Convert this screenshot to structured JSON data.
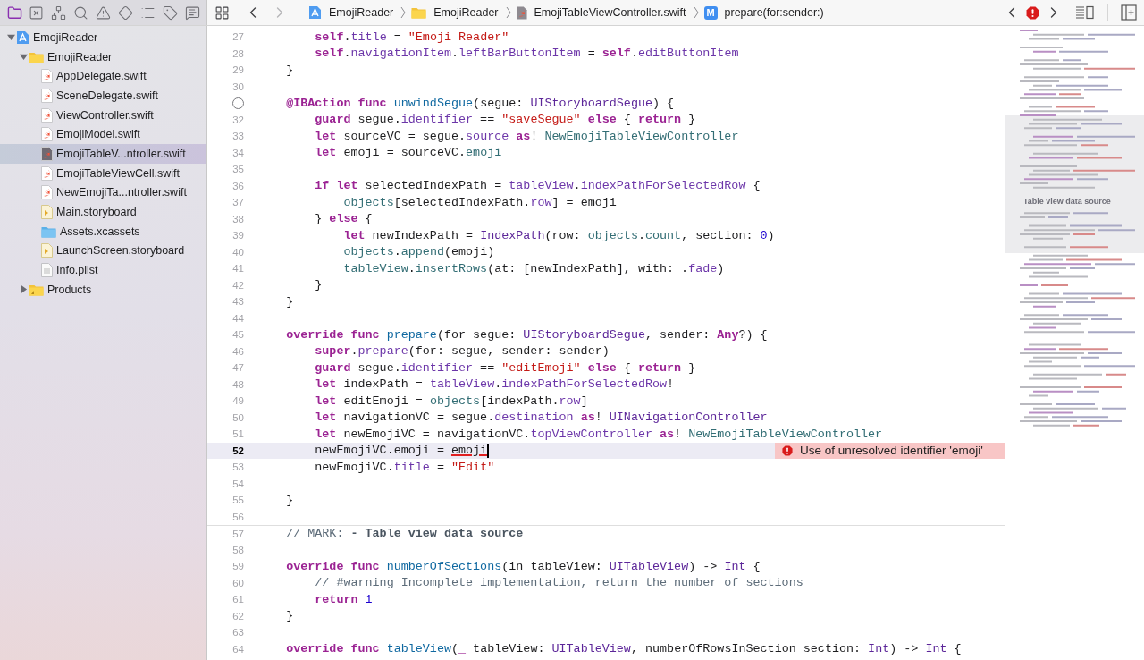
{
  "navigator": {
    "tabs": [
      {
        "selected": true
      },
      {
        "selected": false
      },
      {
        "selected": false
      },
      {
        "selected": false
      },
      {
        "selected": false
      },
      {
        "selected": false
      },
      {
        "selected": false
      },
      {
        "selected": false
      },
      {
        "selected": false
      }
    ],
    "tree": [
      {
        "name": "EmojiReader",
        "kind": "project",
        "expanded": true,
        "selected": false,
        "children": [
          {
            "name": "EmojiReader",
            "kind": "folder",
            "expanded": true,
            "selected": false,
            "children": [
              {
                "name": "AppDelegate.swift",
                "kind": "swift",
                "selected": false
              },
              {
                "name": "SceneDelegate.swift",
                "kind": "swift",
                "selected": false
              },
              {
                "name": "ViewController.swift",
                "kind": "swift",
                "selected": false
              },
              {
                "name": "EmojiModel.swift",
                "kind": "swift",
                "selected": false
              },
              {
                "name": "EmojiTableV...ntroller.swift",
                "kind": "swift",
                "selected": true
              },
              {
                "name": "EmojiTableViewCell.swift",
                "kind": "swift",
                "selected": false
              },
              {
                "name": "NewEmojiTa...ntroller.swift",
                "kind": "swift",
                "selected": false
              },
              {
                "name": "Main.storyboard",
                "kind": "storyboard",
                "selected": false
              },
              {
                "name": "Assets.xcassets",
                "kind": "assets",
                "selected": false
              },
              {
                "name": "LaunchScreen.storyboard",
                "kind": "storyboard",
                "selected": false
              },
              {
                "name": "Info.plist",
                "kind": "plist",
                "selected": false
              }
            ]
          },
          {
            "name": "Products",
            "kind": "products",
            "expanded": false,
            "selected": false
          }
        ]
      }
    ]
  },
  "editor": {
    "history": [
      {
        "disabled": false
      },
      {
        "disabled": true
      }
    ],
    "breadcrumbs": [
      {
        "kind": "project",
        "label": "EmojiReader"
      },
      {
        "kind": "folder",
        "label": "EmojiReader"
      },
      {
        "kind": "swift",
        "label": "EmojiTableViewController.swift"
      },
      {
        "kind": "method",
        "badge": "M",
        "label": "prepare(for:sender:)"
      }
    ],
    "lines": [
      {
        "number": "27",
        "tokens": [
          {
            "kind": "kw",
            "text": "        self"
          },
          {
            "kind": "plain",
            "text": "."
          },
          {
            "kind": "prop",
            "text": "title"
          },
          {
            "kind": "plain",
            "text": " = "
          },
          {
            "kind": "str",
            "text": "\"Emoji Reader\""
          }
        ]
      },
      {
        "number": "28",
        "tokens": [
          {
            "kind": "kw",
            "text": "        self"
          },
          {
            "kind": "plain",
            "text": "."
          },
          {
            "kind": "prop",
            "text": "navigationItem"
          },
          {
            "kind": "plain",
            "text": "."
          },
          {
            "kind": "prop",
            "text": "leftBarButtonItem"
          },
          {
            "kind": "plain",
            "text": " = "
          },
          {
            "kind": "kw",
            "text": "self"
          },
          {
            "kind": "plain",
            "text": "."
          },
          {
            "kind": "prop",
            "text": "editButtonItem"
          }
        ]
      },
      {
        "number": "29",
        "tokens": [
          {
            "kind": "plain",
            "text": "    }"
          }
        ]
      },
      {
        "number": "30"
      },
      {
        "connection": true,
        "tokens": [
          {
            "kind": "kw",
            "text": "    @IBAction func "
          },
          {
            "kind": "decl",
            "text": "unwindSegue"
          },
          {
            "kind": "plain",
            "text": "(segue: "
          },
          {
            "kind": "type",
            "text": "UIStoryboardSegue"
          },
          {
            "kind": "plain",
            "text": ") {"
          }
        ]
      },
      {
        "number": "32",
        "tokens": [
          {
            "kind": "kw",
            "text": "        guard"
          },
          {
            "kind": "plain",
            "text": " segue."
          },
          {
            "kind": "prop",
            "text": "identifier"
          },
          {
            "kind": "plain",
            "text": " == "
          },
          {
            "kind": "str",
            "text": "\"saveSegue\""
          },
          {
            "kind": "kw",
            "text": " else"
          },
          {
            "kind": "plain",
            "text": " { "
          },
          {
            "kind": "kw",
            "text": "return"
          },
          {
            "kind": "plain",
            "text": " }"
          }
        ]
      },
      {
        "number": "33",
        "tokens": [
          {
            "kind": "kw",
            "text": "        let"
          },
          {
            "kind": "plain",
            "text": " sourceVC = segue."
          },
          {
            "kind": "prop",
            "text": "source"
          },
          {
            "kind": "kw",
            "text": " as"
          },
          {
            "kind": "plain",
            "text": "! "
          },
          {
            "kind": "ptype",
            "text": "NewEmojiTableViewController"
          }
        ]
      },
      {
        "number": "34",
        "tokens": [
          {
            "kind": "kw",
            "text": "        let"
          },
          {
            "kind": "plain",
            "text": " emoji = sourceVC."
          },
          {
            "kind": "pprop",
            "text": "emoji"
          }
        ]
      },
      {
        "number": "35"
      },
      {
        "number": "36",
        "tokens": [
          {
            "kind": "kw",
            "text": "        if let"
          },
          {
            "kind": "plain",
            "text": " selectedIndexPath = "
          },
          {
            "kind": "prop",
            "text": "tableView"
          },
          {
            "kind": "plain",
            "text": "."
          },
          {
            "kind": "prop",
            "text": "indexPathForSelectedRow"
          },
          {
            "kind": "plain",
            "text": " {"
          }
        ]
      },
      {
        "number": "37",
        "tokens": [
          {
            "kind": "pprop",
            "text": "            objects"
          },
          {
            "kind": "plain",
            "text": "[selectedIndexPath."
          },
          {
            "kind": "prop",
            "text": "row"
          },
          {
            "kind": "plain",
            "text": "] = emoji"
          }
        ]
      },
      {
        "number": "38",
        "tokens": [
          {
            "kind": "plain",
            "text": "        } "
          },
          {
            "kind": "kw",
            "text": "else"
          },
          {
            "kind": "plain",
            "text": " {"
          }
        ]
      },
      {
        "number": "39",
        "tokens": [
          {
            "kind": "kw",
            "text": "            let"
          },
          {
            "kind": "plain",
            "text": " newIndexPath = "
          },
          {
            "kind": "type",
            "text": "IndexPath"
          },
          {
            "kind": "plain",
            "text": "(row: "
          },
          {
            "kind": "pprop",
            "text": "objects"
          },
          {
            "kind": "plain",
            "text": "."
          },
          {
            "kind": "pprop",
            "text": "count"
          },
          {
            "kind": "plain",
            "text": ", section: "
          },
          {
            "kind": "num",
            "text": "0"
          },
          {
            "kind": "plain",
            "text": ")"
          }
        ]
      },
      {
        "number": "40",
        "tokens": [
          {
            "kind": "pprop",
            "text": "            objects"
          },
          {
            "kind": "plain",
            "text": "."
          },
          {
            "kind": "pprop",
            "text": "append"
          },
          {
            "kind": "plain",
            "text": "(emoji)"
          }
        ]
      },
      {
        "number": "41",
        "tokens": [
          {
            "kind": "pprop",
            "text": "            tableView"
          },
          {
            "kind": "plain",
            "text": "."
          },
          {
            "kind": "pprop",
            "text": "insertRows"
          },
          {
            "kind": "plain",
            "text": "(at: [newIndexPath], with: ."
          },
          {
            "kind": "prop",
            "text": "fade"
          },
          {
            "kind": "plain",
            "text": ")"
          }
        ]
      },
      {
        "number": "42",
        "tokens": [
          {
            "kind": "plain",
            "text": "        }"
          }
        ]
      },
      {
        "number": "43",
        "tokens": [
          {
            "kind": "plain",
            "text": "    }"
          }
        ]
      },
      {
        "number": "44"
      },
      {
        "number": "45",
        "tokens": [
          {
            "kind": "kw",
            "text": "    override func "
          },
          {
            "kind": "decl",
            "text": "prepare"
          },
          {
            "kind": "plain",
            "text": "(for segue: "
          },
          {
            "kind": "type",
            "text": "UIStoryboardSegue"
          },
          {
            "kind": "plain",
            "text": ", sender: "
          },
          {
            "kind": "kw",
            "text": "Any"
          },
          {
            "kind": "plain",
            "text": "?) {"
          }
        ]
      },
      {
        "number": "46",
        "tokens": [
          {
            "kind": "kw",
            "text": "        super"
          },
          {
            "kind": "plain",
            "text": "."
          },
          {
            "kind": "prop",
            "text": "prepare"
          },
          {
            "kind": "plain",
            "text": "(for: segue, sender: sender)"
          }
        ]
      },
      {
        "number": "47",
        "tokens": [
          {
            "kind": "kw",
            "text": "        guard"
          },
          {
            "kind": "plain",
            "text": " segue."
          },
          {
            "kind": "prop",
            "text": "identifier"
          },
          {
            "kind": "plain",
            "text": " == "
          },
          {
            "kind": "str",
            "text": "\"editEmoji\""
          },
          {
            "kind": "kw",
            "text": " else"
          },
          {
            "kind": "plain",
            "text": " { "
          },
          {
            "kind": "kw",
            "text": "return"
          },
          {
            "kind": "plain",
            "text": " }"
          }
        ]
      },
      {
        "number": "48",
        "tokens": [
          {
            "kind": "kw",
            "text": "        let"
          },
          {
            "kind": "plain",
            "text": " indexPath = "
          },
          {
            "kind": "prop",
            "text": "tableView"
          },
          {
            "kind": "plain",
            "text": "."
          },
          {
            "kind": "prop",
            "text": "indexPathForSelectedRow"
          },
          {
            "kind": "plain",
            "text": "!"
          }
        ]
      },
      {
        "number": "49",
        "tokens": [
          {
            "kind": "kw",
            "text": "        let"
          },
          {
            "kind": "plain",
            "text": " editEmoji = "
          },
          {
            "kind": "pprop",
            "text": "objects"
          },
          {
            "kind": "plain",
            "text": "[indexPath."
          },
          {
            "kind": "prop",
            "text": "row"
          },
          {
            "kind": "plain",
            "text": "]"
          }
        ]
      },
      {
        "number": "50",
        "tokens": [
          {
            "kind": "kw",
            "text": "        let"
          },
          {
            "kind": "plain",
            "text": " navigationVC = segue."
          },
          {
            "kind": "prop",
            "text": "destination"
          },
          {
            "kind": "kw",
            "text": " as"
          },
          {
            "kind": "plain",
            "text": "! "
          },
          {
            "kind": "type",
            "text": "UINavigationController"
          }
        ]
      },
      {
        "number": "51",
        "tokens": [
          {
            "kind": "kw",
            "text": "        let"
          },
          {
            "kind": "plain",
            "text": " newEmojiVC = navigationVC."
          },
          {
            "kind": "prop",
            "text": "topViewController"
          },
          {
            "kind": "kw",
            "text": " as"
          },
          {
            "kind": "plain",
            "text": "! "
          },
          {
            "kind": "ptype",
            "text": "NewEmojiTableViewController"
          }
        ]
      },
      {
        "number": "52",
        "current": true,
        "cursor": true,
        "tokens": [
          {
            "kind": "plain",
            "text": "        newEmojiVC.emoji = "
          },
          {
            "kind": "err",
            "text": "emoji"
          }
        ],
        "annotation": "Use of unresolved identifier 'emoji'"
      },
      {
        "number": "53",
        "tokens": [
          {
            "kind": "plain",
            "text": "        newEmojiVC."
          },
          {
            "kind": "prop",
            "text": "title"
          },
          {
            "kind": "plain",
            "text": " = "
          },
          {
            "kind": "str",
            "text": "\"Edit\""
          }
        ]
      },
      {
        "number": "54"
      },
      {
        "number": "55",
        "tokens": [
          {
            "kind": "plain",
            "text": "    }"
          }
        ]
      },
      {
        "number": "56"
      },
      {
        "number": "57",
        "separator": true,
        "tokens": [
          {
            "kind": "cmt",
            "text": "    // MARK: "
          },
          {
            "kind": "mark",
            "text": "- Table view data source"
          }
        ]
      },
      {
        "number": "58"
      },
      {
        "number": "59",
        "tokens": [
          {
            "kind": "kw",
            "text": "    override func "
          },
          {
            "kind": "decl",
            "text": "numberOfSections"
          },
          {
            "kind": "plain",
            "text": "(in tableView: "
          },
          {
            "kind": "type",
            "text": "UITableView"
          },
          {
            "kind": "plain",
            "text": ") -> "
          },
          {
            "kind": "type",
            "text": "Int"
          },
          {
            "kind": "plain",
            "text": " {"
          }
        ]
      },
      {
        "number": "60",
        "tokens": [
          {
            "kind": "cmt",
            "text": "        // #warning Incomplete implementation, return the number of sections"
          }
        ]
      },
      {
        "number": "61",
        "tokens": [
          {
            "kind": "kw",
            "text": "        return "
          },
          {
            "kind": "num",
            "text": "1"
          }
        ]
      },
      {
        "number": "62",
        "tokens": [
          {
            "kind": "plain",
            "text": "    }"
          }
        ]
      },
      {
        "number": "63"
      },
      {
        "number": "64",
        "tokens": [
          {
            "kind": "kw",
            "text": "    override func "
          },
          {
            "kind": "decl",
            "text": "tableView"
          },
          {
            "kind": "plain",
            "text": "("
          },
          {
            "kind": "kw",
            "text": "_"
          },
          {
            "kind": "plain",
            "text": " tableView: "
          },
          {
            "kind": "type",
            "text": "UITableView"
          },
          {
            "kind": "plain",
            "text": ", numberOfRowsInSection section: "
          },
          {
            "kind": "type",
            "text": "Int"
          },
          {
            "kind": "plain",
            "text": ") -> "
          },
          {
            "kind": "type",
            "text": "Int"
          },
          {
            "kind": "plain",
            "text": " {"
          }
        ]
      }
    ]
  },
  "minimap": {
    "mark_label": "Table view data source"
  }
}
